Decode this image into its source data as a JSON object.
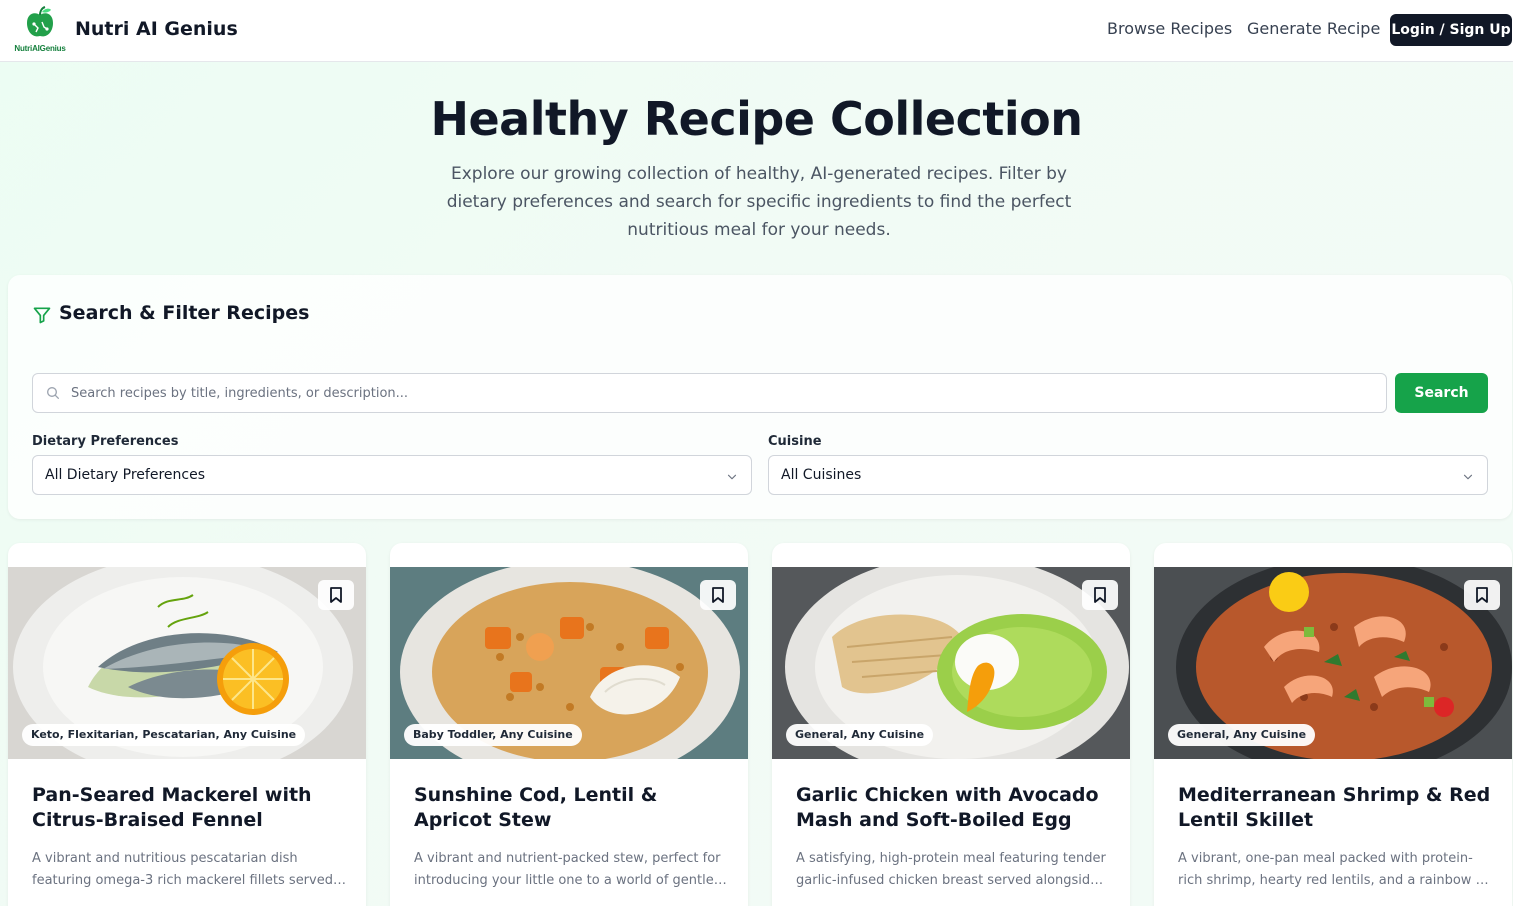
{
  "header": {
    "logo_text": "NutriAIGenius",
    "brand_name": "Nutri AI Genius",
    "nav": [
      "Browse Recipes",
      "Generate Recipe"
    ],
    "login_label": "Login / Sign Up"
  },
  "hero": {
    "title": "Healthy Recipe Collection",
    "subtitle": "Explore our growing collection of healthy, AI-generated recipes. Filter by dietary preferences and search for specific ingredients to find the perfect nutritious meal for your needs."
  },
  "filters": {
    "title": "Search & Filter Recipes",
    "search_placeholder": "Search recipes by title, ingredients, or description...",
    "search_value": "",
    "search_button": "Search",
    "dietary_label": "Dietary Preferences",
    "dietary_value": "All Dietary Preferences",
    "cuisine_label": "Cuisine",
    "cuisine_value": "All Cuisines"
  },
  "recipes": [
    {
      "tags": "Keto, Flexitarian, Pescatarian, Any Cuisine",
      "title": "Pan-Seared Mackerel with Citrus-Braised Fennel",
      "description": "A vibrant and nutritious pescatarian dish featuring omega-3 rich mackerel fillets served…"
    },
    {
      "tags": "Baby Toddler, Any Cuisine",
      "title": "Sunshine Cod, Lentil & Apricot Stew",
      "description": "A vibrant and nutrient-packed stew, perfect for introducing your little one to a world of gentle…"
    },
    {
      "tags": "General, Any Cuisine",
      "title": "Garlic Chicken with Avocado Mash and Soft-Boiled Egg",
      "description": "A satisfying, high-protein meal featuring tender garlic-infused chicken breast served alongside …"
    },
    {
      "tags": "General, Any Cuisine",
      "title": "Mediterranean Shrimp & Red Lentil Skillet",
      "description": "A vibrant, one-pan meal packed with protein-rich shrimp, hearty red lentils, and a rainbow of fres…"
    }
  ],
  "icons": {
    "logo": "apple-leaf-icon",
    "filter": "filter-funnel-icon",
    "search": "search-icon",
    "chevron": "chevron-down-icon",
    "bookmark": "bookmark-icon"
  },
  "colors": {
    "accent": "#16a34a",
    "dark_button": "#111827",
    "background": "#ecfdf3"
  }
}
